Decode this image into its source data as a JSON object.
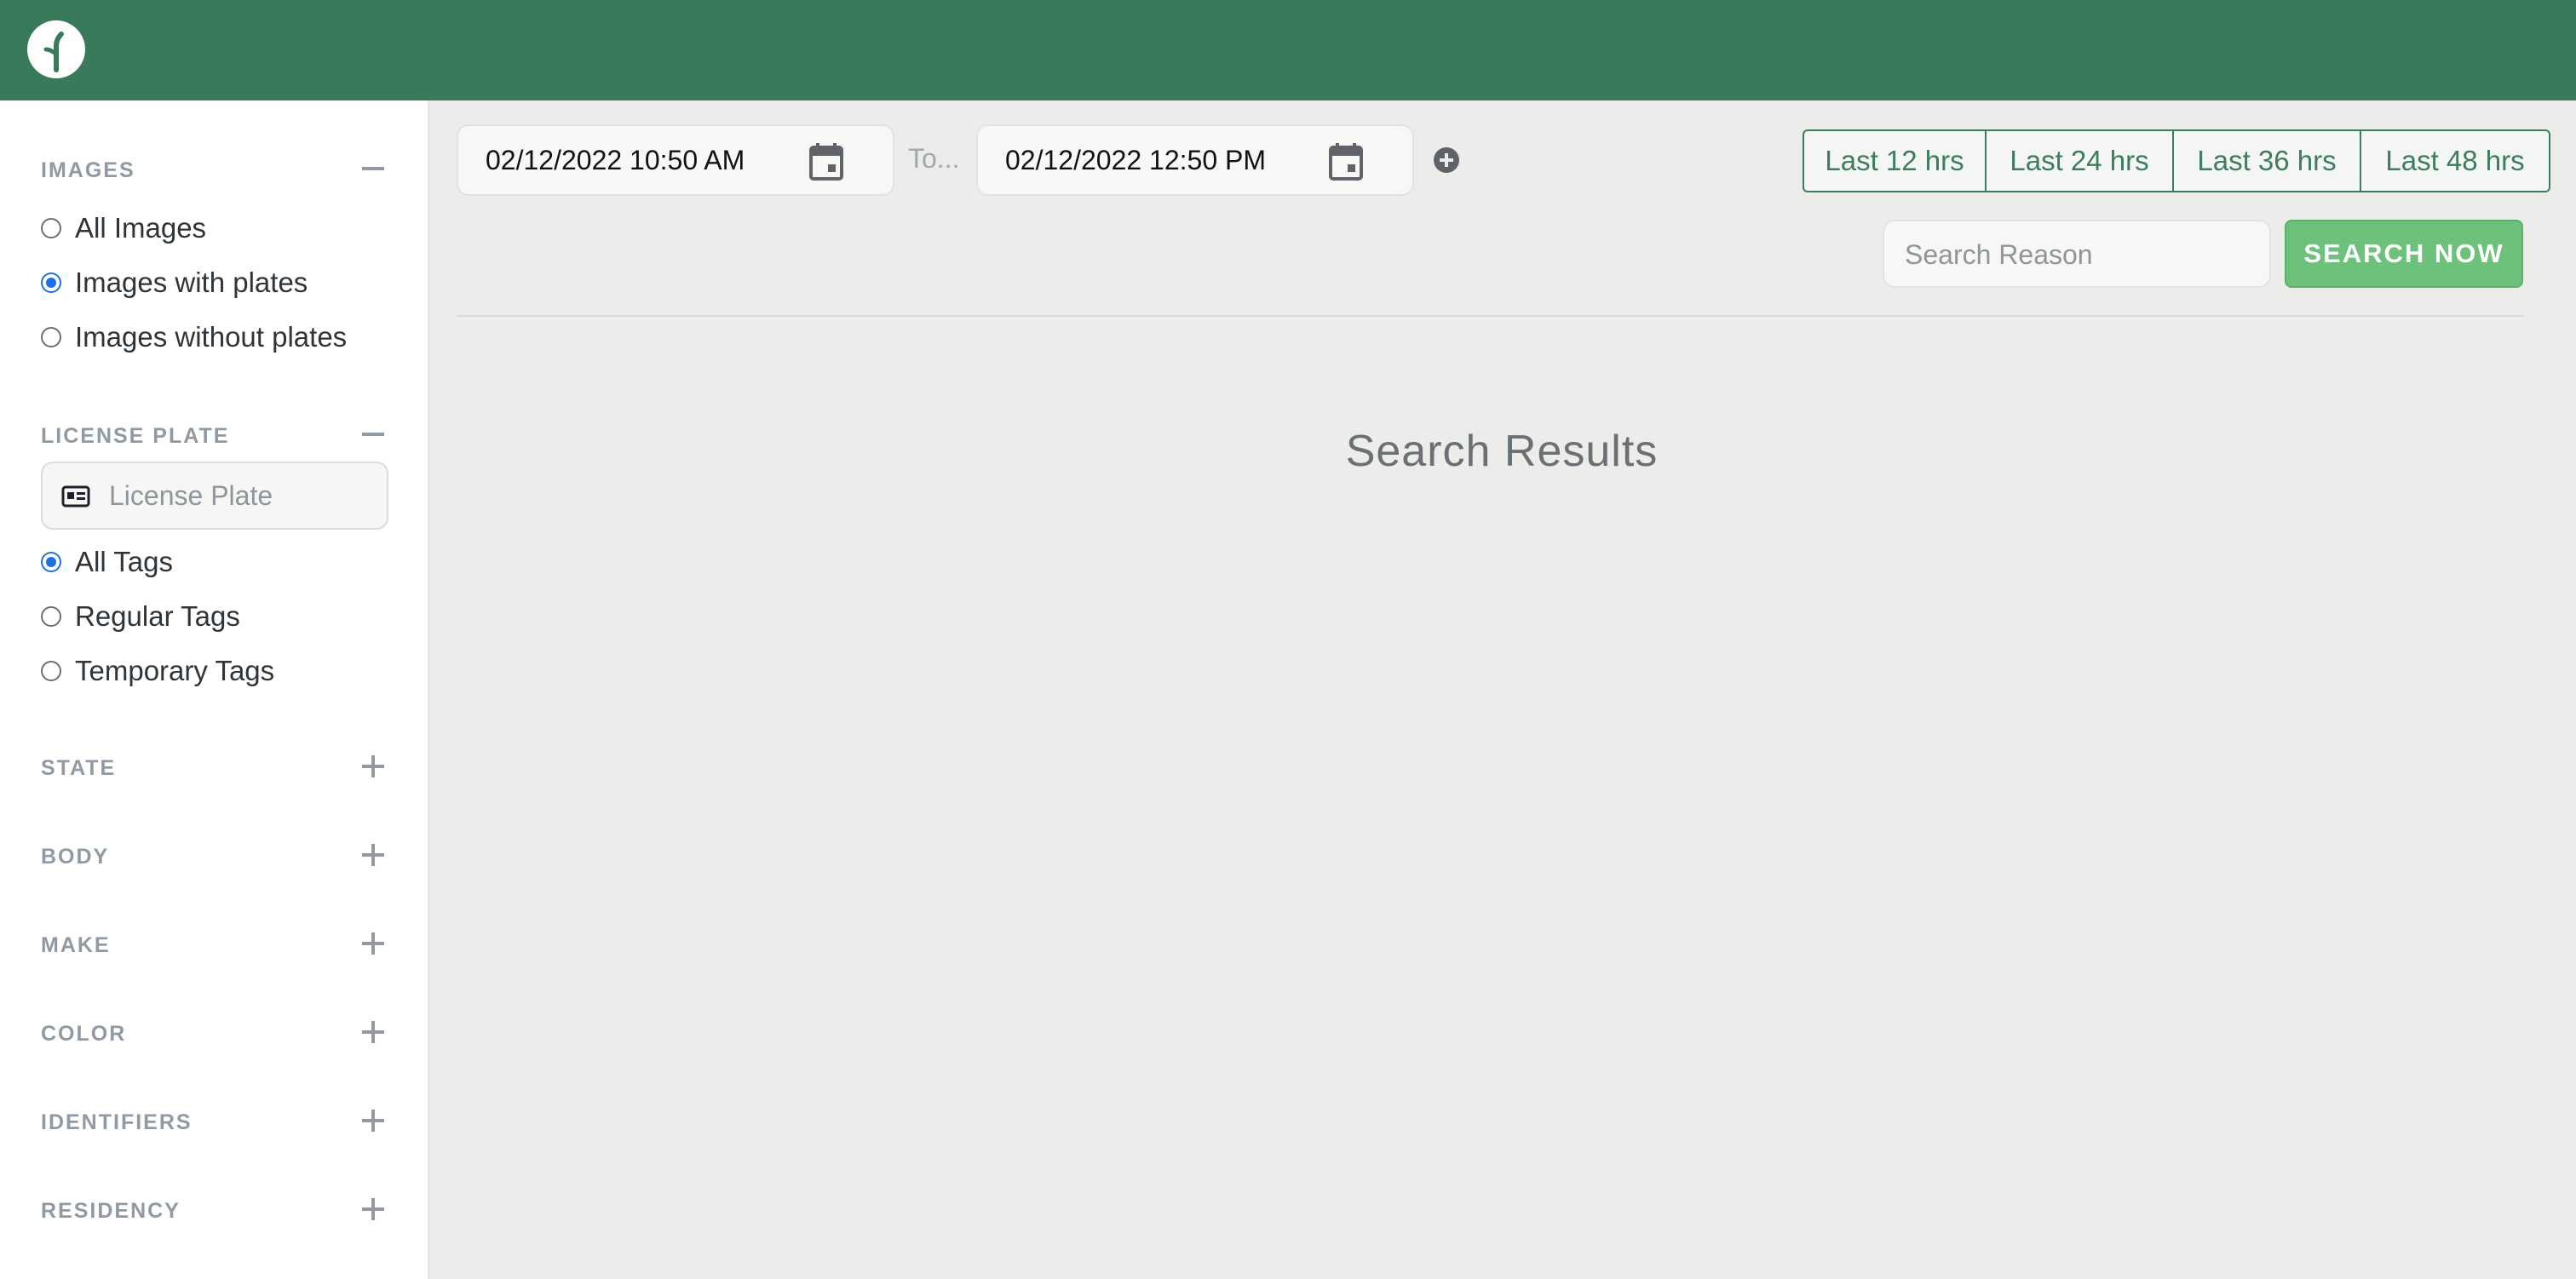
{
  "colors": {
    "brand": "#397a5a",
    "accent_button": "#6cc27b",
    "radio_selected": "#1f6fe5"
  },
  "header": {
    "logo_icon": "sprout-logo-icon"
  },
  "sidebar": {
    "images": {
      "title": "IMAGES",
      "toggle": "minus",
      "options": [
        {
          "label": "All Images",
          "selected": false
        },
        {
          "label": "Images with plates",
          "selected": true
        },
        {
          "label": "Images without plates",
          "selected": false
        }
      ]
    },
    "license_plate": {
      "title": "LICENSE PLATE",
      "toggle": "minus",
      "input_placeholder": "License Plate",
      "input_icon": "id-card-icon",
      "options": [
        {
          "label": "All Tags",
          "selected": true
        },
        {
          "label": "Regular Tags",
          "selected": false
        },
        {
          "label": "Temporary Tags",
          "selected": false
        }
      ]
    },
    "collapsed_sections": [
      {
        "title": "STATE",
        "toggle": "plus"
      },
      {
        "title": "BODY",
        "toggle": "plus"
      },
      {
        "title": "MAKE",
        "toggle": "plus"
      },
      {
        "title": "COLOR",
        "toggle": "plus"
      },
      {
        "title": "IDENTIFIERS",
        "toggle": "plus"
      },
      {
        "title": "RESIDENCY",
        "toggle": "plus"
      }
    ]
  },
  "toolbar": {
    "start_date": "02/12/2022 10:50 AM",
    "to_label": "To...",
    "end_date": "02/12/2022 12:50 PM",
    "range_buttons": [
      "Last 12 hrs",
      "Last 24 hrs",
      "Last 36 hrs",
      "Last 48 hrs"
    ],
    "search_reason_placeholder": "Search Reason",
    "search_button_label": "SEARCH NOW"
  },
  "results": {
    "title": "Search Results"
  }
}
